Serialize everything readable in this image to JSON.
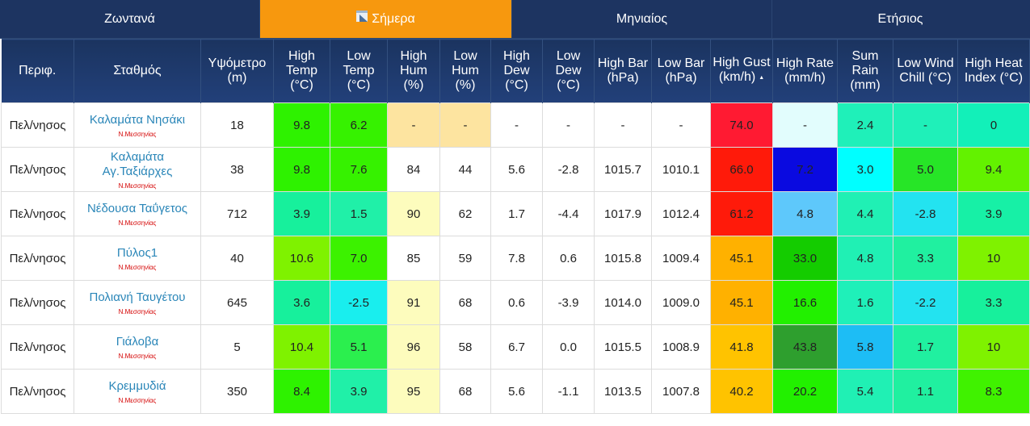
{
  "tabs": [
    {
      "label": "Ζωντανά",
      "active": false
    },
    {
      "label": "Σήμερα",
      "active": true
    },
    {
      "label": "Μηνιαίος",
      "active": false
    },
    {
      "label": "Ετήσιος",
      "active": false
    }
  ],
  "headers": [
    {
      "key": "region",
      "label": "Περιφ."
    },
    {
      "key": "station",
      "label": "Σταθμός"
    },
    {
      "key": "altitude",
      "label": "Υψόμετρο (m)"
    },
    {
      "key": "high_temp",
      "label": "High Temp (°C)"
    },
    {
      "key": "low_temp",
      "label": "Low Temp (°C)"
    },
    {
      "key": "high_hum",
      "label": "High Hum (%)"
    },
    {
      "key": "low_hum",
      "label": "Low Hum (%)"
    },
    {
      "key": "high_dew",
      "label": "High Dew (°C)"
    },
    {
      "key": "low_dew",
      "label": "Low Dew (°C)"
    },
    {
      "key": "high_bar",
      "label": "High Bar (hPa)"
    },
    {
      "key": "low_bar",
      "label": "Low Bar (hPa)"
    },
    {
      "key": "high_gust",
      "label": "High Gust (km/h)",
      "sorted": "asc"
    },
    {
      "key": "high_rate",
      "label": "High Rate (mm/h)"
    },
    {
      "key": "sum_rain",
      "label": "Sum Rain (mm)"
    },
    {
      "key": "low_wind_chill",
      "label": "Low Wind Chill (°C)"
    },
    {
      "key": "high_heat_index",
      "label": "High Heat Index (°C)"
    }
  ],
  "rows": [
    {
      "region": "Πελ/νησος",
      "station": "Καλαμάτα Νησάκι",
      "sub": "Ν.Μεσσηνίας",
      "altitude": "18",
      "cells": [
        {
          "value": "9.8",
          "color": "#2ef200"
        },
        {
          "value": "6.2",
          "color": "#36f200"
        },
        {
          "value": "-",
          "color": "#fde4a0"
        },
        {
          "value": "-",
          "color": "#fde4a0"
        },
        {
          "value": "-",
          "color": "#ffffff"
        },
        {
          "value": "-",
          "color": "#ffffff"
        },
        {
          "value": "-",
          "color": "#ffffff"
        },
        {
          "value": "-",
          "color": "#ffffff"
        },
        {
          "value": "74.0",
          "color": "#ff1a32"
        },
        {
          "value": "-",
          "color": "#e2fdfd"
        },
        {
          "value": "2.4",
          "color": "#1ff0b9"
        },
        {
          "value": "-",
          "color": "#1ff0b9"
        },
        {
          "value": "0",
          "color": "#12f0b9"
        }
      ]
    },
    {
      "region": "Πελ/νησος",
      "station": "Καλαμάτα Αγ.Ταξιάρχες",
      "sub": "Ν.Μεσσηνίας",
      "altitude": "38",
      "cells": [
        {
          "value": "9.8",
          "color": "#2ef200"
        },
        {
          "value": "7.6",
          "color": "#36f200"
        },
        {
          "value": "84",
          "color": "#ffffff"
        },
        {
          "value": "44",
          "color": "#ffffff"
        },
        {
          "value": "5.6",
          "color": "#ffffff"
        },
        {
          "value": "-2.8",
          "color": "#ffffff"
        },
        {
          "value": "1015.7",
          "color": "#ffffff"
        },
        {
          "value": "1010.1",
          "color": "#ffffff"
        },
        {
          "value": "66.0",
          "color": "#ff1a0a"
        },
        {
          "value": "7.2",
          "color": "#0a0ae0"
        },
        {
          "value": "3.0",
          "color": "#00ffff"
        },
        {
          "value": "5.0",
          "color": "#27e527"
        },
        {
          "value": "9.4",
          "color": "#63f200"
        }
      ]
    },
    {
      "region": "Πελ/νησος",
      "station": "Νέδουσα Ταΰγετος",
      "sub": "Ν.Μεσσηνίας",
      "altitude": "712",
      "cells": [
        {
          "value": "3.9",
          "color": "#17f09c"
        },
        {
          "value": "1.5",
          "color": "#20f0a8"
        },
        {
          "value": "90",
          "color": "#fdfcbd"
        },
        {
          "value": "62",
          "color": "#ffffff"
        },
        {
          "value": "1.7",
          "color": "#ffffff"
        },
        {
          "value": "-4.4",
          "color": "#ffffff"
        },
        {
          "value": "1017.9",
          "color": "#ffffff"
        },
        {
          "value": "1012.4",
          "color": "#ffffff"
        },
        {
          "value": "61.2",
          "color": "#ff1a0a"
        },
        {
          "value": "4.8",
          "color": "#5ec8fb"
        },
        {
          "value": "4.4",
          "color": "#20f0b4"
        },
        {
          "value": "-2.8",
          "color": "#23e3f0"
        },
        {
          "value": "3.9",
          "color": "#17f0a6"
        }
      ]
    },
    {
      "region": "Πελ/νησος",
      "station": "Πύλος1",
      "sub": "Ν.Μεσσηνίας",
      "altitude": "40",
      "cells": [
        {
          "value": "10.6",
          "color": "#7ff200"
        },
        {
          "value": "7.0",
          "color": "#3cf200"
        },
        {
          "value": "85",
          "color": "#ffffff"
        },
        {
          "value": "59",
          "color": "#ffffff"
        },
        {
          "value": "7.8",
          "color": "#ffffff"
        },
        {
          "value": "0.6",
          "color": "#ffffff"
        },
        {
          "value": "1015.8",
          "color": "#ffffff"
        },
        {
          "value": "1009.4",
          "color": "#ffffff"
        },
        {
          "value": "45.1",
          "color": "#ffb100"
        },
        {
          "value": "33.0",
          "color": "#14cc00"
        },
        {
          "value": "4.8",
          "color": "#20f0b4"
        },
        {
          "value": "3.3",
          "color": "#20f0a0"
        },
        {
          "value": "10",
          "color": "#7ff200"
        }
      ]
    },
    {
      "region": "Πελ/νησος",
      "station": "Πολιανή Ταυγέτου",
      "sub": "Ν.Μεσσηνίας",
      "altitude": "645",
      "cells": [
        {
          "value": "3.6",
          "color": "#17f09c"
        },
        {
          "value": "-2.5",
          "color": "#19eeee"
        },
        {
          "value": "91",
          "color": "#fdfcbd"
        },
        {
          "value": "68",
          "color": "#ffffff"
        },
        {
          "value": "0.6",
          "color": "#ffffff"
        },
        {
          "value": "-3.9",
          "color": "#ffffff"
        },
        {
          "value": "1014.0",
          "color": "#ffffff"
        },
        {
          "value": "1009.0",
          "color": "#ffffff"
        },
        {
          "value": "45.1",
          "color": "#ffb100"
        },
        {
          "value": "16.6",
          "color": "#22f000"
        },
        {
          "value": "1.6",
          "color": "#1ff0b9"
        },
        {
          "value": "-2.2",
          "color": "#23e3f0"
        },
        {
          "value": "3.3",
          "color": "#17f09c"
        }
      ]
    },
    {
      "region": "Πελ/νησος",
      "station": "Γιάλοβα",
      "sub": "Ν.Μεσσηνίας",
      "altitude": "5",
      "cells": [
        {
          "value": "10.4",
          "color": "#7ff200"
        },
        {
          "value": "5.1",
          "color": "#2bef4e"
        },
        {
          "value": "96",
          "color": "#fdfcbd"
        },
        {
          "value": "58",
          "color": "#ffffff"
        },
        {
          "value": "6.7",
          "color": "#ffffff"
        },
        {
          "value": "0.0",
          "color": "#ffffff"
        },
        {
          "value": "1015.5",
          "color": "#ffffff"
        },
        {
          "value": "1008.9",
          "color": "#ffffff"
        },
        {
          "value": "41.8",
          "color": "#ffc300"
        },
        {
          "value": "43.8",
          "color": "#2e9f2e"
        },
        {
          "value": "5.8",
          "color": "#1dbdf5"
        },
        {
          "value": "1.7",
          "color": "#20f0a0"
        },
        {
          "value": "10",
          "color": "#7ff200"
        }
      ]
    },
    {
      "region": "Πελ/νησος",
      "station": "Κρεμμυδιά",
      "sub": "Ν.Μεσσηνίας",
      "altitude": "350",
      "cells": [
        {
          "value": "8.4",
          "color": "#2ef200"
        },
        {
          "value": "3.9",
          "color": "#20f0a8"
        },
        {
          "value": "95",
          "color": "#fdfcbd"
        },
        {
          "value": "68",
          "color": "#ffffff"
        },
        {
          "value": "5.6",
          "color": "#ffffff"
        },
        {
          "value": "-1.1",
          "color": "#ffffff"
        },
        {
          "value": "1013.5",
          "color": "#ffffff"
        },
        {
          "value": "1007.8",
          "color": "#ffffff"
        },
        {
          "value": "40.2",
          "color": "#ffc300"
        },
        {
          "value": "20.2",
          "color": "#22f000"
        },
        {
          "value": "5.4",
          "color": "#20f0b4"
        },
        {
          "value": "1.1",
          "color": "#20f0a0"
        },
        {
          "value": "8.3",
          "color": "#40f200"
        }
      ]
    }
  ]
}
